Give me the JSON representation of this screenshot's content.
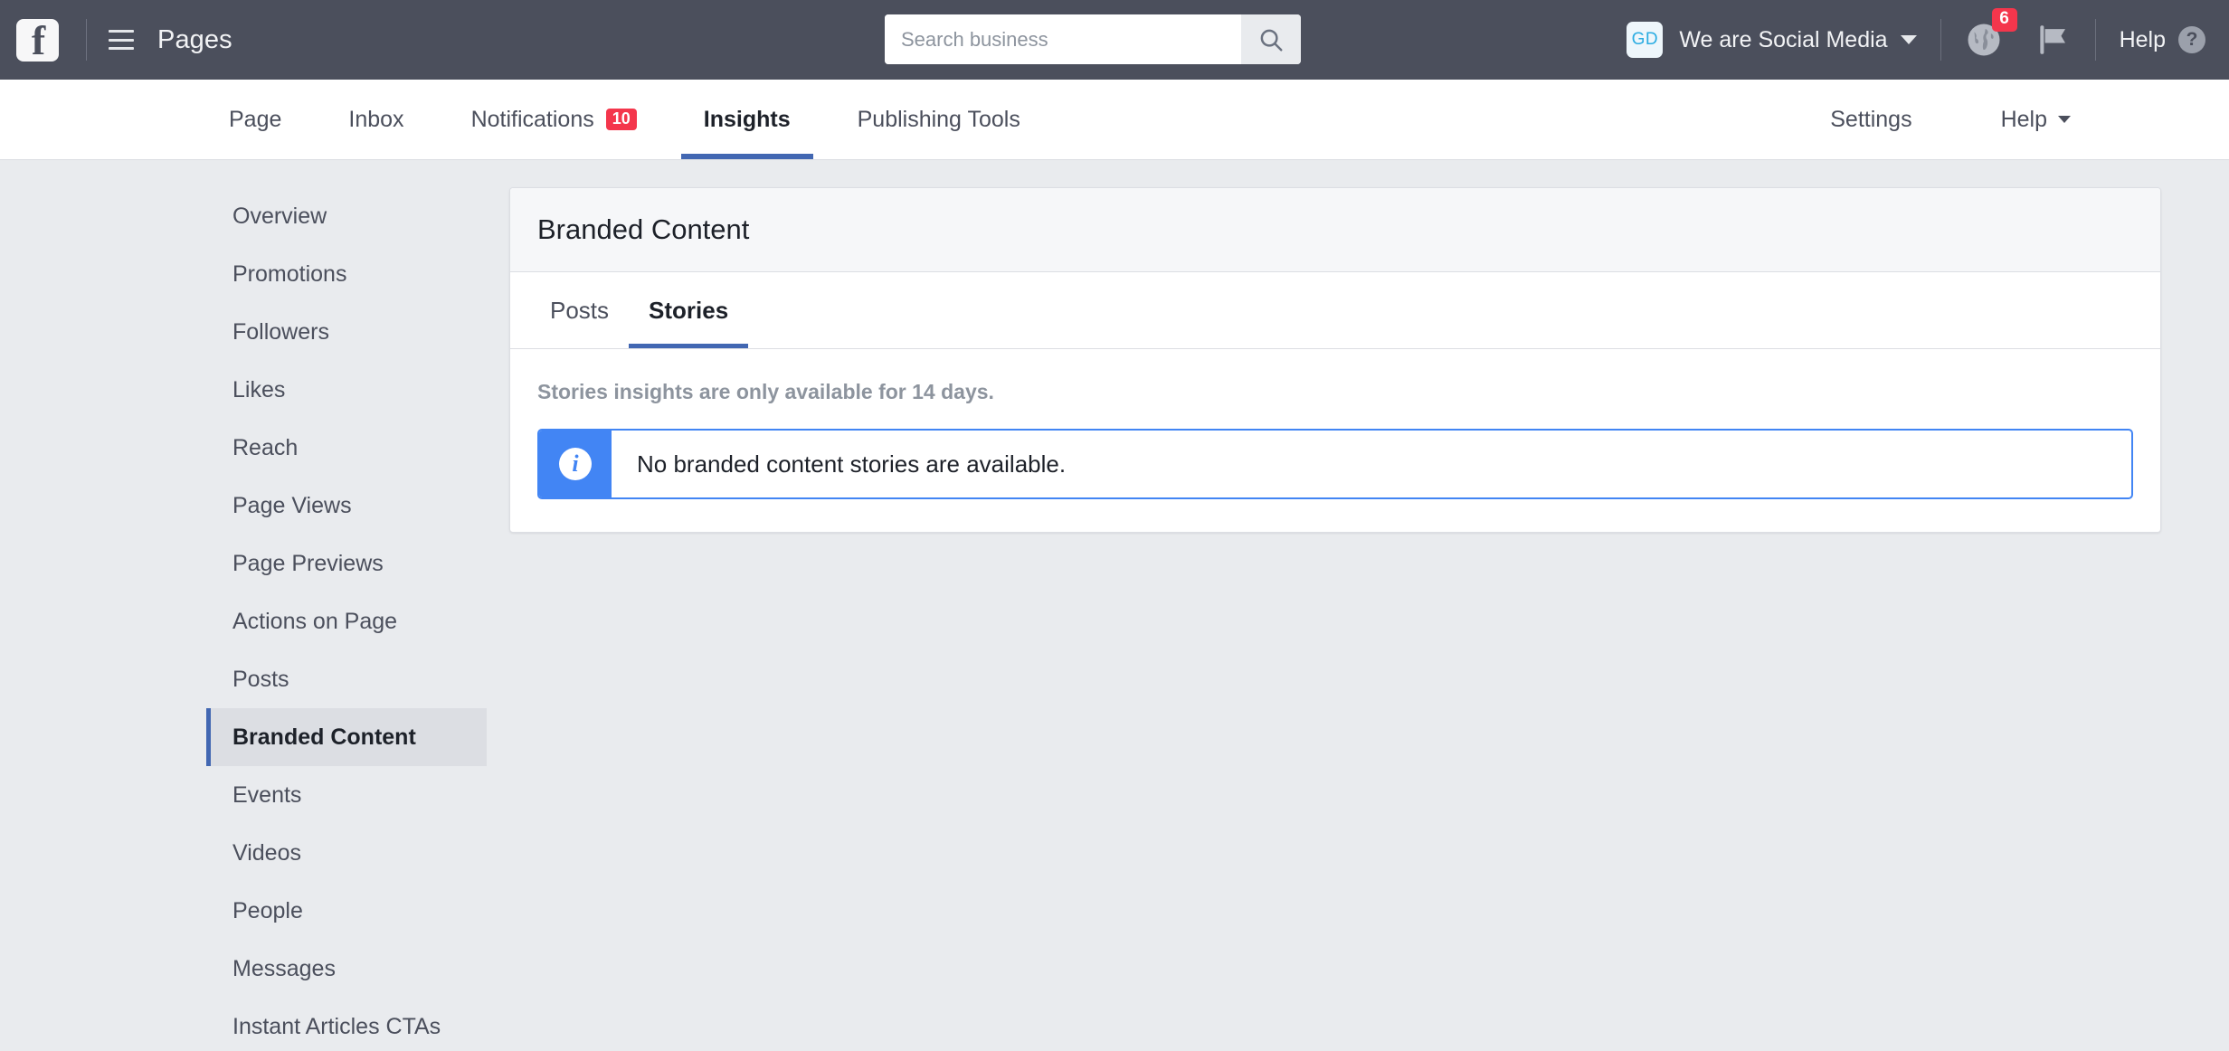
{
  "topbar": {
    "logo_icon": "facebook-logo-icon",
    "logo_letter": "f",
    "menu_icon": "hamburger-menu-icon",
    "title": "Pages",
    "search": {
      "placeholder": "Search business",
      "value": "",
      "icon": "search-icon"
    },
    "account": {
      "avatar_initials": "GD",
      "name": "We are Social Media",
      "caret_icon": "chevron-down-icon"
    },
    "globe": {
      "icon": "globe-icon",
      "badge": "6"
    },
    "flag": {
      "icon": "flag-icon"
    },
    "help": {
      "label": "Help",
      "icon": "question-mark-icon"
    }
  },
  "nav": {
    "items": [
      {
        "label": "Page",
        "badge": "",
        "active": false
      },
      {
        "label": "Inbox",
        "badge": "",
        "active": false
      },
      {
        "label": "Notifications",
        "badge": "10",
        "active": false
      },
      {
        "label": "Insights",
        "badge": "",
        "active": true
      },
      {
        "label": "Publishing Tools",
        "badge": "",
        "active": false
      }
    ],
    "settings_label": "Settings",
    "help_label": "Help",
    "help_caret_icon": "chevron-down-icon"
  },
  "sidebar": {
    "items": [
      {
        "label": "Overview",
        "active": false
      },
      {
        "label": "Promotions",
        "active": false
      },
      {
        "label": "Followers",
        "active": false
      },
      {
        "label": "Likes",
        "active": false
      },
      {
        "label": "Reach",
        "active": false
      },
      {
        "label": "Page Views",
        "active": false
      },
      {
        "label": "Page Previews",
        "active": false
      },
      {
        "label": "Actions on Page",
        "active": false
      },
      {
        "label": "Posts",
        "active": false
      },
      {
        "label": "Branded Content",
        "active": true
      },
      {
        "label": "Events",
        "active": false
      },
      {
        "label": "Videos",
        "active": false
      },
      {
        "label": "People",
        "active": false
      },
      {
        "label": "Messages",
        "active": false
      },
      {
        "label": "Instant Articles CTAs",
        "active": false
      }
    ]
  },
  "card": {
    "title": "Branded Content",
    "tabs": [
      {
        "label": "Posts",
        "active": false
      },
      {
        "label": "Stories",
        "active": true
      }
    ],
    "notice": "Stories insights are only available for 14 days.",
    "info": {
      "icon": "info-icon",
      "message": "No branded content stories are available."
    }
  },
  "colors": {
    "topbar_bg": "#4b4f5c",
    "page_bg": "#e9ebee",
    "accent_blue": "#4267b2",
    "info_blue": "#4285f4",
    "badge_red": "#f4364c",
    "avatar_text": "#2aace2"
  }
}
